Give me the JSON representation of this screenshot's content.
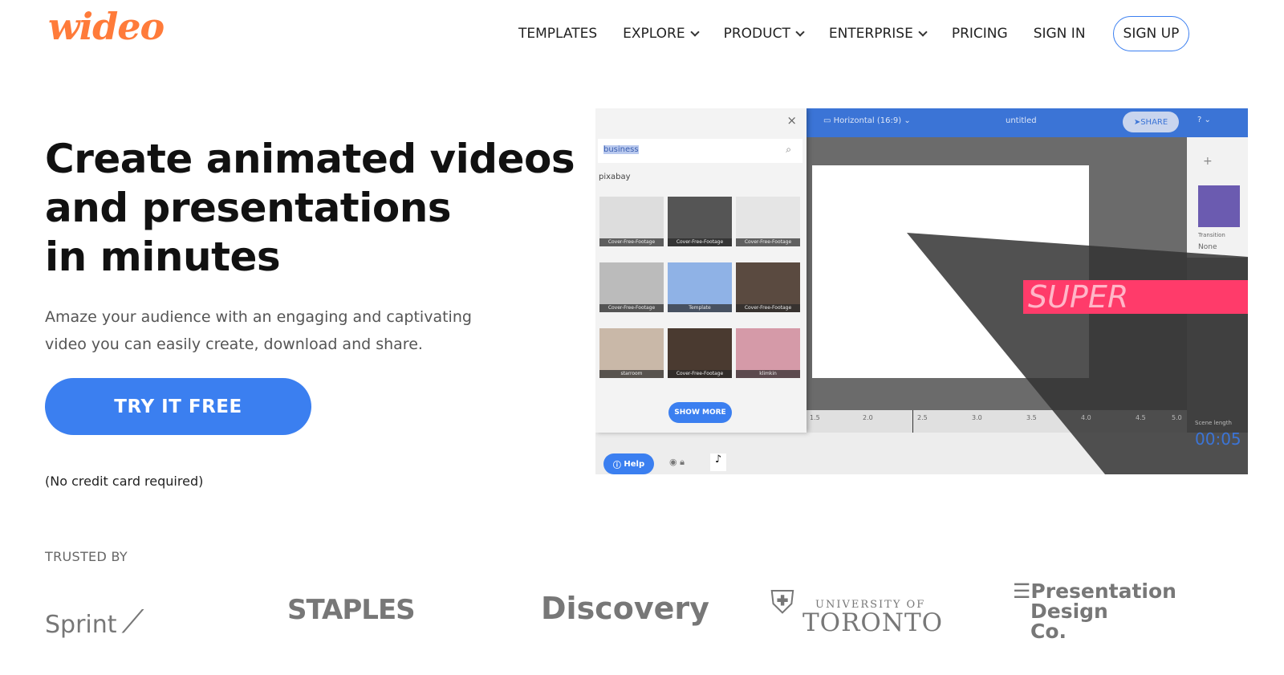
{
  "brand": {
    "logo": "wideo",
    "accent": "#ff7b3a",
    "primary": "#3b7ff0"
  },
  "nav": {
    "items": [
      {
        "label": "TEMPLATES"
      },
      {
        "label": "EXPLORE",
        "dropdown": true
      },
      {
        "label": "PRODUCT",
        "dropdown": true
      },
      {
        "label": "ENTERPRISE",
        "dropdown": true
      },
      {
        "label": "PRICING"
      },
      {
        "label": "SIGN IN"
      }
    ],
    "signup": "SIGN UP"
  },
  "hero": {
    "title_lines": [
      "Create animated videos",
      "and presentations",
      "in minutes"
    ],
    "subtitle_lines": [
      "Amaze your audience with an engaging and captivating",
      "video you can easily create, download and share."
    ],
    "cta": "TRY IT FREE",
    "note": "(No credit card required)"
  },
  "editor": {
    "format": "Horizontal (16:9)",
    "doc_title": "untitled",
    "share": "SHARE",
    "search_value": "business",
    "source": "pixabay",
    "thumbs": [
      "Cover-Free-Footage",
      "Cover-Free-Footage",
      "Cover-Free-Footage",
      "Cover-Free-Footage",
      "Template",
      "Cover-Free-Footage",
      "starroom",
      "Cover-Free-Footage",
      "klimkin"
    ],
    "show_more": "SHOW MORE",
    "help": "Help",
    "slide_text": "SUPER",
    "transition_label": "Transition",
    "transition_value": "None",
    "timeline_ticks": [
      "1.5",
      "2.0",
      "2.5",
      "3.0",
      "3.5",
      "4.0",
      "4.5",
      "5.0"
    ],
    "scene_length_label": "Scene length",
    "scene_length": "00:05"
  },
  "trusted": {
    "label": "TRUSTED BY",
    "logos": [
      "Sprint",
      "STAPLES",
      "Discovery",
      "UNIVERSITY OF",
      "TORONTO",
      "Presentation",
      "Design",
      "Co."
    ]
  }
}
